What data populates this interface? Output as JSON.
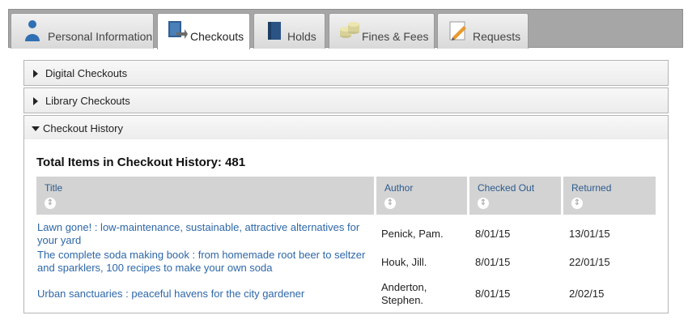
{
  "tabs": [
    {
      "label": "Personal Information",
      "icon": "person-icon"
    },
    {
      "label": "Checkouts",
      "icon": "checkout-book-icon",
      "active": true
    },
    {
      "label": "Holds",
      "icon": "book-icon"
    },
    {
      "label": "Fines & Fees",
      "icon": "coins-icon"
    },
    {
      "label": "Requests",
      "icon": "pencil-paper-icon"
    }
  ],
  "sections": [
    {
      "label": "Digital Checkouts",
      "expanded": false
    },
    {
      "label": "Library Checkouts",
      "expanded": false
    },
    {
      "label": "Checkout History",
      "expanded": true
    }
  ],
  "history": {
    "total_label": "Total Items in Checkout History: 481",
    "columns": [
      "Title",
      "Author",
      "Checked Out",
      "Returned"
    ],
    "rows": [
      {
        "title": "Lawn gone! : low-maintenance, sustainable, attractive alternatives for your yard",
        "author": "Penick, Pam.",
        "checked_out": "8/01/15",
        "returned": "13/01/15"
      },
      {
        "title": "The complete soda making book : from homemade root beer to seltzer and sparklers, 100 recipes to make your own soda",
        "author": "Houk, Jill.",
        "checked_out": "8/01/15",
        "returned": "22/01/15"
      },
      {
        "title": "Urban sanctuaries : peaceful havens for the city gardener",
        "author": "Anderton, Stephen.",
        "checked_out": "8/01/15",
        "returned": "2/02/15"
      }
    ]
  },
  "colors": {
    "link": "#2d67a7",
    "header_text": "#2c5a8c",
    "tabbar": "#a6a6a6"
  }
}
